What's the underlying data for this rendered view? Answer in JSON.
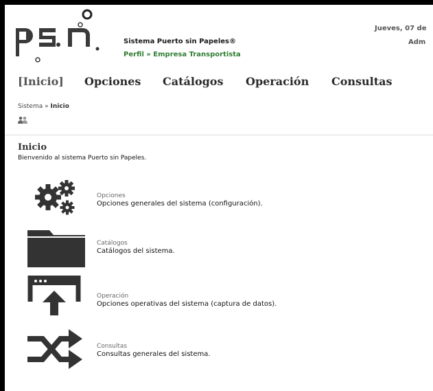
{
  "header": {
    "title": "Sistema Puerto sin Papeles®",
    "profile": "Perfil » Empresa Transportista",
    "date": "Jueves, 07 de",
    "user": "Adm"
  },
  "nav": [
    "[Inicio]",
    "Opciones",
    "Catálogos",
    "Operación",
    "Consultas"
  ],
  "breadcrumb": {
    "root": "Sistema",
    "separator": " » ",
    "current": "Inicio"
  },
  "page": {
    "title": "Inicio",
    "welcome": "Bienvenido al sistema Puerto sin Papeles."
  },
  "sections": [
    {
      "name": "Opciones",
      "description": "Opciones generales del sistema (configuración).",
      "icon": "gears-icon"
    },
    {
      "name": "Catálogos",
      "description": "Catálogos del sistema.",
      "icon": "folder-icon"
    },
    {
      "name": "Operación",
      "description": "Opciones operativas del sistema (captura de datos).",
      "icon": "window-upload-icon"
    },
    {
      "name": "Consultas",
      "description": "Consultas generales del sistema.",
      "icon": "shuffle-icon"
    }
  ],
  "colors": {
    "brand_green": "#2e7d32",
    "icon_dark": "#333333",
    "frame": "#000000"
  }
}
